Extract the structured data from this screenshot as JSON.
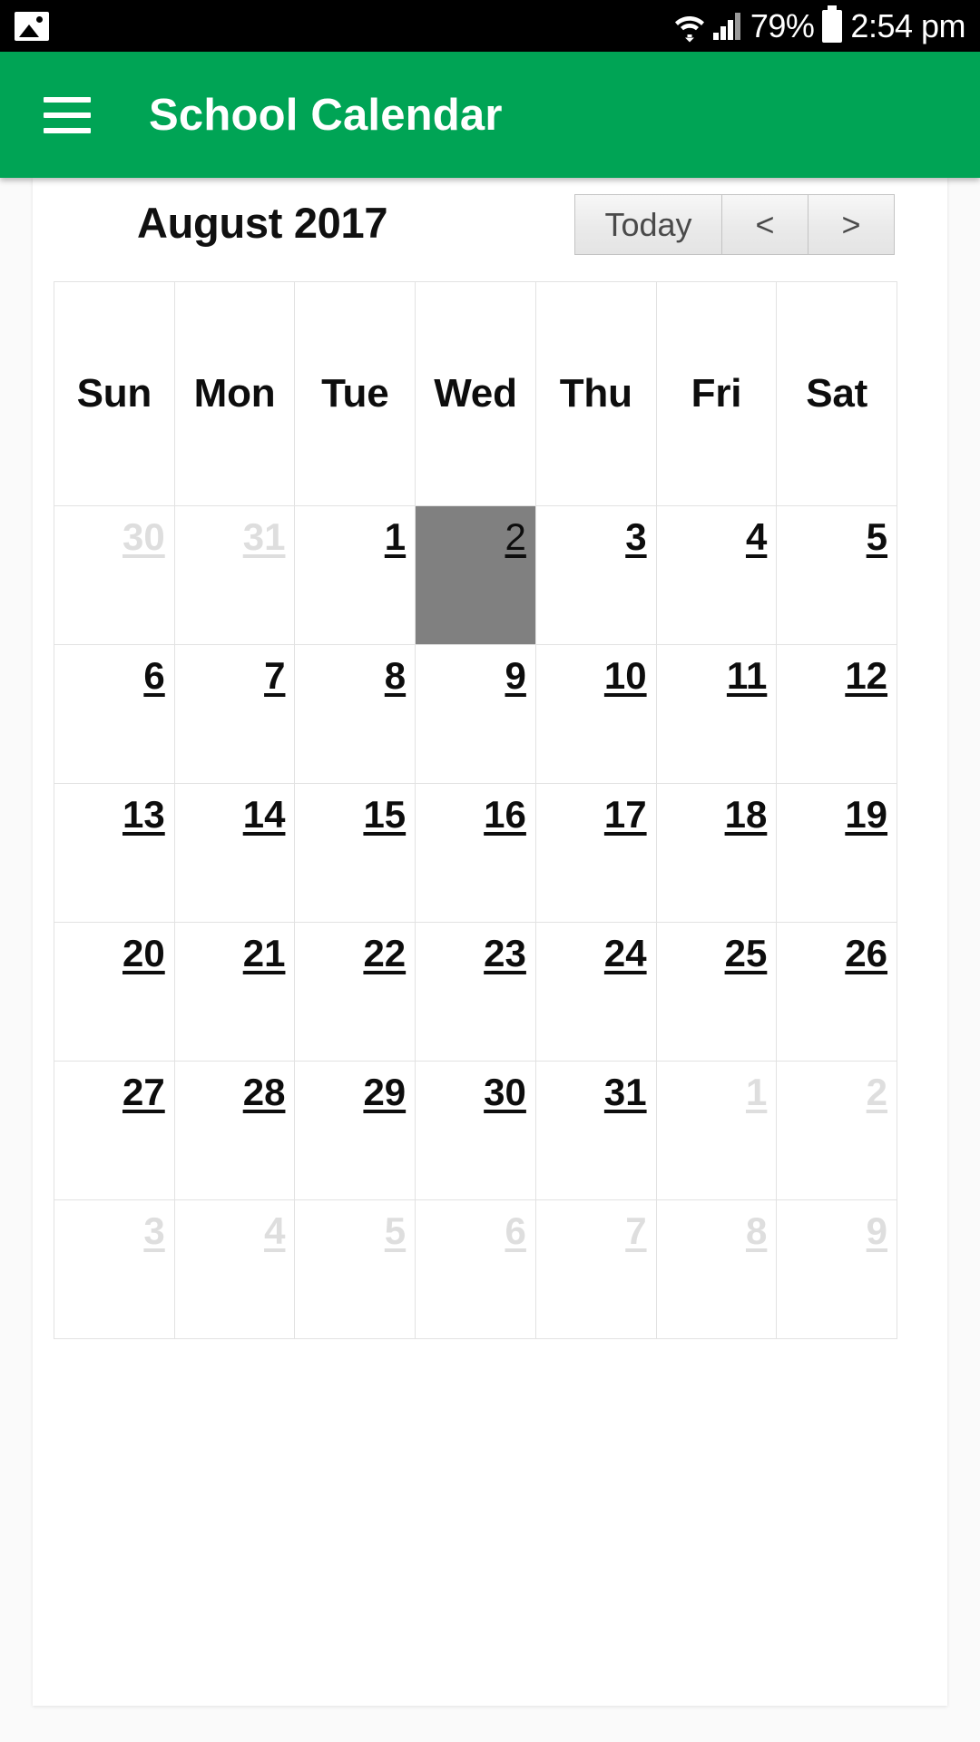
{
  "status_bar": {
    "image_icon": "image-icon",
    "wifi_icon": "wifi-icon",
    "signal_icon": "cellular-signal-icon",
    "battery_percent": "79%",
    "battery_icon": "battery-icon",
    "time": "2:54 pm"
  },
  "app_bar": {
    "menu_icon": "hamburger-menu-icon",
    "title": "School Calendar",
    "background_color": "#00a455"
  },
  "toolbar": {
    "month_title": "August 2017",
    "today_label": "Today",
    "prev_label": "<",
    "next_label": ">"
  },
  "calendar": {
    "weekdays": [
      "Sun",
      "Mon",
      "Tue",
      "Wed",
      "Thu",
      "Fri",
      "Sat"
    ],
    "selected_day": "2",
    "selected_color": "#808080",
    "other_month_color": "#dedede",
    "weeks": [
      [
        {
          "label": "30",
          "other_month": true,
          "selected": false
        },
        {
          "label": "31",
          "other_month": true,
          "selected": false
        },
        {
          "label": "1",
          "other_month": false,
          "selected": false
        },
        {
          "label": "2",
          "other_month": false,
          "selected": true
        },
        {
          "label": "3",
          "other_month": false,
          "selected": false
        },
        {
          "label": "4",
          "other_month": false,
          "selected": false
        },
        {
          "label": "5",
          "other_month": false,
          "selected": false
        }
      ],
      [
        {
          "label": "6",
          "other_month": false,
          "selected": false
        },
        {
          "label": "7",
          "other_month": false,
          "selected": false
        },
        {
          "label": "8",
          "other_month": false,
          "selected": false
        },
        {
          "label": "9",
          "other_month": false,
          "selected": false
        },
        {
          "label": "10",
          "other_month": false,
          "selected": false
        },
        {
          "label": "11",
          "other_month": false,
          "selected": false
        },
        {
          "label": "12",
          "other_month": false,
          "selected": false
        }
      ],
      [
        {
          "label": "13",
          "other_month": false,
          "selected": false
        },
        {
          "label": "14",
          "other_month": false,
          "selected": false
        },
        {
          "label": "15",
          "other_month": false,
          "selected": false
        },
        {
          "label": "16",
          "other_month": false,
          "selected": false
        },
        {
          "label": "17",
          "other_month": false,
          "selected": false
        },
        {
          "label": "18",
          "other_month": false,
          "selected": false
        },
        {
          "label": "19",
          "other_month": false,
          "selected": false
        }
      ],
      [
        {
          "label": "20",
          "other_month": false,
          "selected": false
        },
        {
          "label": "21",
          "other_month": false,
          "selected": false
        },
        {
          "label": "22",
          "other_month": false,
          "selected": false
        },
        {
          "label": "23",
          "other_month": false,
          "selected": false
        },
        {
          "label": "24",
          "other_month": false,
          "selected": false
        },
        {
          "label": "25",
          "other_month": false,
          "selected": false
        },
        {
          "label": "26",
          "other_month": false,
          "selected": false
        }
      ],
      [
        {
          "label": "27",
          "other_month": false,
          "selected": false
        },
        {
          "label": "28",
          "other_month": false,
          "selected": false
        },
        {
          "label": "29",
          "other_month": false,
          "selected": false
        },
        {
          "label": "30",
          "other_month": false,
          "selected": false
        },
        {
          "label": "31",
          "other_month": false,
          "selected": false
        },
        {
          "label": "1",
          "other_month": true,
          "selected": false
        },
        {
          "label": "2",
          "other_month": true,
          "selected": false
        }
      ],
      [
        {
          "label": "3",
          "other_month": true,
          "selected": false
        },
        {
          "label": "4",
          "other_month": true,
          "selected": false
        },
        {
          "label": "5",
          "other_month": true,
          "selected": false
        },
        {
          "label": "6",
          "other_month": true,
          "selected": false
        },
        {
          "label": "7",
          "other_month": true,
          "selected": false
        },
        {
          "label": "8",
          "other_month": true,
          "selected": false
        },
        {
          "label": "9",
          "other_month": true,
          "selected": false
        }
      ]
    ]
  }
}
